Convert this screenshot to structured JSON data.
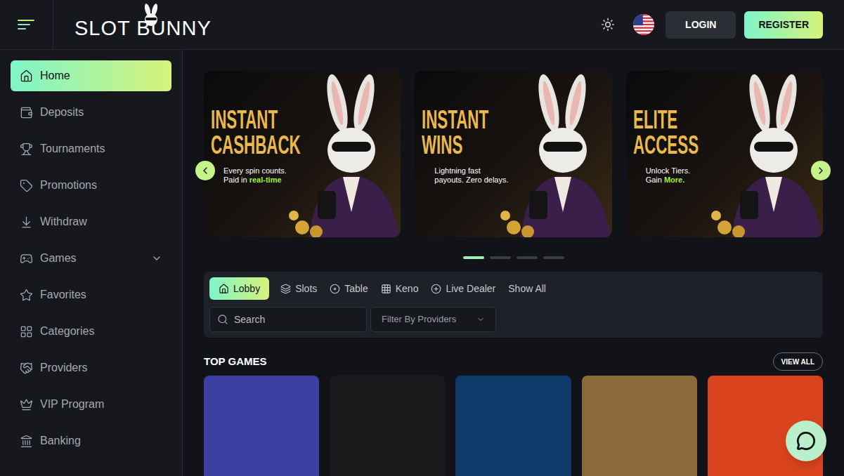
{
  "header": {
    "logo": "SLOT BUNNY",
    "buttons": [
      {
        "label": "LOGIN",
        "kind": "secondary"
      },
      {
        "label": "REGISTER",
        "kind": "primary"
      }
    ]
  },
  "sidebar": {
    "items": [
      {
        "label": "Home",
        "selected": true,
        "kind": "link",
        "expanded": false
      },
      {
        "label": "Deposits",
        "selected": false,
        "kind": "link",
        "expanded": false
      },
      {
        "label": "Tournaments",
        "selected": false,
        "kind": "link",
        "expanded": false
      },
      {
        "label": "Promotions",
        "selected": false,
        "kind": "link",
        "expanded": false
      },
      {
        "label": "Withdraw",
        "selected": false,
        "kind": "link",
        "expanded": false
      },
      {
        "label": "Games",
        "selected": false,
        "kind": "group",
        "expanded": false
      },
      {
        "label": "Favorites",
        "selected": false,
        "kind": "link",
        "expanded": false
      },
      {
        "label": "Categories",
        "selected": false,
        "kind": "link",
        "expanded": false
      },
      {
        "label": "Providers",
        "selected": false,
        "kind": "link",
        "expanded": false
      },
      {
        "label": "VIP Program",
        "selected": false,
        "kind": "link",
        "expanded": false
      },
      {
        "label": "Banking",
        "selected": false,
        "kind": "link",
        "expanded": false
      }
    ]
  },
  "banners": [
    {
      "title_lines": [
        "INSTANT",
        "CASHBACK"
      ],
      "subtitle": [
        [
          {
            "text": "Every spin counts.",
            "highlight": false
          }
        ],
        [
          {
            "text": "Paid in ",
            "highlight": false
          },
          {
            "text": "real-time",
            "highlight": true
          }
        ]
      ]
    },
    {
      "title_lines": [
        "INSTANT",
        "WINS"
      ],
      "subtitle": [
        [
          {
            "text": "Lightning fast",
            "highlight": false
          }
        ],
        [
          {
            "text": "payouts. ",
            "highlight": false
          },
          {
            "text": "Zero delays.",
            "highlight": false
          }
        ]
      ]
    },
    {
      "title_lines": [
        "ELITE",
        "ACCESS"
      ],
      "subtitle": [
        [
          {
            "text": "Unlock Tiers.",
            "highlight": false
          }
        ],
        [
          {
            "text": "Gain ",
            "highlight": false
          },
          {
            "text": "More.",
            "highlight": true
          }
        ]
      ]
    }
  ],
  "carousel_dots": [
    {
      "selected": true
    },
    {
      "selected": false
    },
    {
      "selected": false
    },
    {
      "selected": false
    }
  ],
  "tabs": [
    {
      "label": "Lobby",
      "selected": true
    },
    {
      "label": "Slots",
      "selected": false
    },
    {
      "label": "Table",
      "selected": false
    },
    {
      "label": "Keno",
      "selected": false
    },
    {
      "label": "Live Dealer",
      "selected": false
    },
    {
      "label": "Show All",
      "selected": false
    }
  ],
  "search": {
    "placeholder": "Search"
  },
  "provider_filter": {
    "label": "Filter By Providers"
  },
  "top_games": {
    "title": "TOP GAMES",
    "view_all": "VIEW ALL",
    "cards": [
      {
        "color": "#3b3fa0"
      },
      {
        "color": "#1a1a1c"
      },
      {
        "color": "#0e3a6b"
      },
      {
        "color": "#8a6a3a"
      },
      {
        "color": "#d9441e"
      }
    ]
  }
}
